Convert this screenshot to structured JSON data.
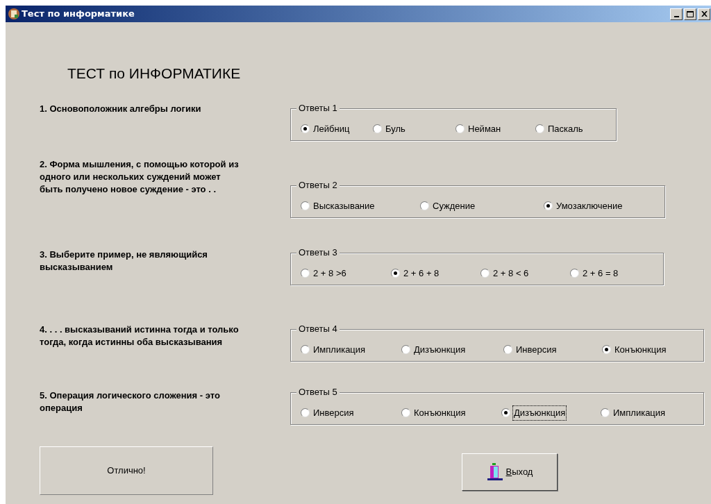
{
  "window": {
    "title": "Тест по информатике"
  },
  "heading": "ТЕСТ по ИНФОРМАТИКЕ",
  "questions": [
    {
      "text": "1. Основоположник алгебры логики",
      "group": "Ответы 1",
      "options": [
        {
          "label": "Лейбниц",
          "selected": true,
          "focused": false
        },
        {
          "label": "Буль",
          "selected": false,
          "focused": false
        },
        {
          "label": "Нейман",
          "selected": false,
          "focused": false
        },
        {
          "label": "Паскаль",
          "selected": false,
          "focused": false
        }
      ]
    },
    {
      "text": "2. Форма мышления, с помощью которой из одного или нескольких суждений может быть получено новое суждение - это . .",
      "group": "Ответы 2",
      "options": [
        {
          "label": "Высказывание",
          "selected": false,
          "focused": false
        },
        {
          "label": "Суждение",
          "selected": false,
          "focused": false
        },
        {
          "label": "Умозаключение",
          "selected": true,
          "focused": false
        }
      ]
    },
    {
      "text": "3. Выберите пример, не являющийся высказыванием",
      "group": "Ответы 3",
      "options": [
        {
          "label": "2 + 8 >6",
          "selected": false,
          "focused": false
        },
        {
          "label": "2 + 6 + 8",
          "selected": true,
          "focused": false
        },
        {
          "label": "2 + 8 < 6",
          "selected": false,
          "focused": false
        },
        {
          "label": "2 + 6 = 8",
          "selected": false,
          "focused": false
        }
      ]
    },
    {
      "text": "4.  . . . высказываний истинна тогда и только тогда, когда истинны оба высказывания",
      "group": "Ответы 4",
      "options": [
        {
          "label": "Импликация",
          "selected": false,
          "focused": false
        },
        {
          "label": "Дизъюнкция",
          "selected": false,
          "focused": false
        },
        {
          "label": "Инверсия",
          "selected": false,
          "focused": false
        },
        {
          "label": "Конъюнкция",
          "selected": true,
          "focused": false
        }
      ]
    },
    {
      "text": "5. Операция логического сложения - это операция",
      "group": "Ответы 5",
      "options": [
        {
          "label": "Инверсия",
          "selected": false,
          "focused": false
        },
        {
          "label": "Конъюнкция",
          "selected": false,
          "focused": false
        },
        {
          "label": "Дизъюнкция",
          "selected": true,
          "focused": true
        },
        {
          "label": "Импликация",
          "selected": false,
          "focused": false
        }
      ]
    }
  ],
  "result": "Отлично!",
  "exit_button": "Выход"
}
